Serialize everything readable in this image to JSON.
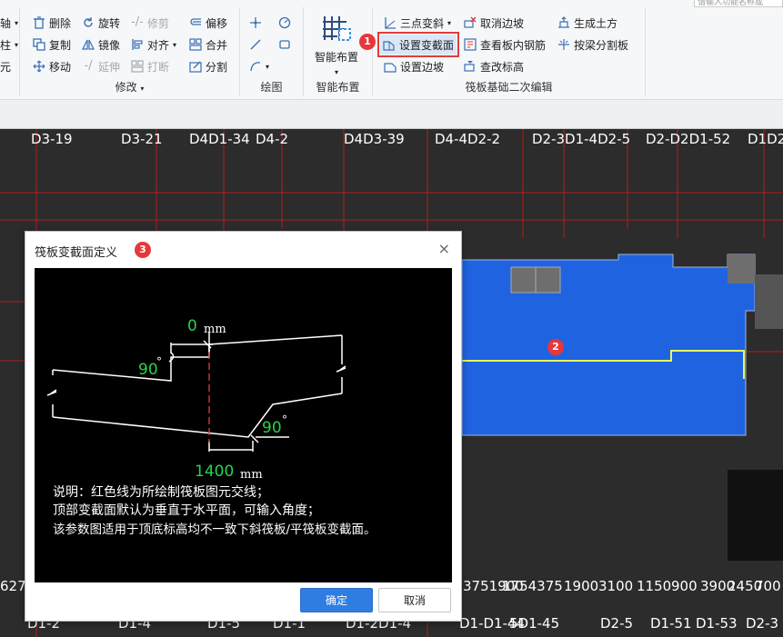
{
  "search": {
    "placeholder": "请输入功能名称或"
  },
  "ribbon": {
    "left_partial": [
      "轴",
      "柱",
      "元"
    ],
    "modify": {
      "label": "修改",
      "buttons": [
        {
          "label": "删除",
          "icon": "delete-icon",
          "enabled": true
        },
        {
          "label": "旋转",
          "icon": "rotate-icon",
          "enabled": true
        },
        {
          "label": "修剪",
          "icon": "trim-icon",
          "enabled": false
        },
        {
          "label": "偏移",
          "icon": "offset-icon",
          "enabled": true
        },
        {
          "label": "复制",
          "icon": "copy-icon",
          "enabled": true
        },
        {
          "label": "镜像",
          "icon": "mirror-icon",
          "enabled": true
        },
        {
          "label": "对齐",
          "icon": "align-icon",
          "enabled": true
        },
        {
          "label": "合并",
          "icon": "merge-icon",
          "enabled": true
        },
        {
          "label": "移动",
          "icon": "move-icon",
          "enabled": true
        },
        {
          "label": "延伸",
          "icon": "extend-icon",
          "enabled": false
        },
        {
          "label": "打断",
          "icon": "break-icon",
          "enabled": false
        },
        {
          "label": "分割",
          "icon": "split-icon",
          "enabled": true
        }
      ]
    },
    "draw": {
      "label": "绘图"
    },
    "smart": {
      "label": "智能布置",
      "button": "智能布置"
    },
    "raft": {
      "label": "筏板基础二次编辑",
      "buttons": [
        {
          "label": "三点变斜",
          "icon": "three-point-slope-icon"
        },
        {
          "label": "取消边坡",
          "icon": "cancel-slope-icon"
        },
        {
          "label": "生成土方",
          "icon": "generate-earthwork-icon"
        },
        {
          "label": "设置变截面",
          "icon": "set-variable-section-icon"
        },
        {
          "label": "查看板内钢筋",
          "icon": "view-rebar-icon"
        },
        {
          "label": "按梁分割板",
          "icon": "split-by-beam-icon"
        },
        {
          "label": "设置边坡",
          "icon": "set-slope-icon"
        },
        {
          "label": "查改标高",
          "icon": "elevation-icon"
        }
      ]
    }
  },
  "badges": [
    "1",
    "2",
    "3"
  ],
  "canvas": {
    "top_labels": [
      "D3-19",
      "D3-21",
      "D4D1-34",
      "D4-2",
      "D4D3-39",
      "D4-4D2-2",
      "D2-3D1-4D2-5",
      "D2-D2D1-52",
      "D1D2"
    ],
    "bottom_numbers": [
      "627",
      "3751900",
      "1754375",
      "1900",
      "3100",
      "1150",
      "900",
      "3900",
      "2450",
      "700"
    ],
    "bottom_labels": [
      "D1-2",
      "D1-4",
      "D1-5",
      "D1-1",
      "D1-2D1-4",
      "D1-D1-44",
      "5D1-45",
      "D2-5",
      "D1-51",
      "D1-53",
      "D2-3"
    ]
  },
  "dialog": {
    "title": "筏板变截面定义",
    "close": "×",
    "figure": {
      "top_offset": "0",
      "top_unit": "mm",
      "top_angle": "90",
      "bottom_angle": "90",
      "bottom_offset": "1400",
      "bottom_unit": "mm",
      "degree": "°"
    },
    "notes": [
      "说明：红色线为所绘制筏板图元交线；",
      "顶部变截面默认为垂直于水平面，可输入角度；",
      "该参数图适用于顶底标高均不一致下斜筏板/平筏板变截面。"
    ],
    "ok": "确定",
    "cancel": "取消"
  },
  "colors": {
    "raft_fill": "#1f63e0",
    "grid_line": "#c21f1f",
    "axis_label": "#ffffff",
    "selection_line": "#e9f55a",
    "accent": "#2f7de1",
    "badge": "#e5383b"
  }
}
